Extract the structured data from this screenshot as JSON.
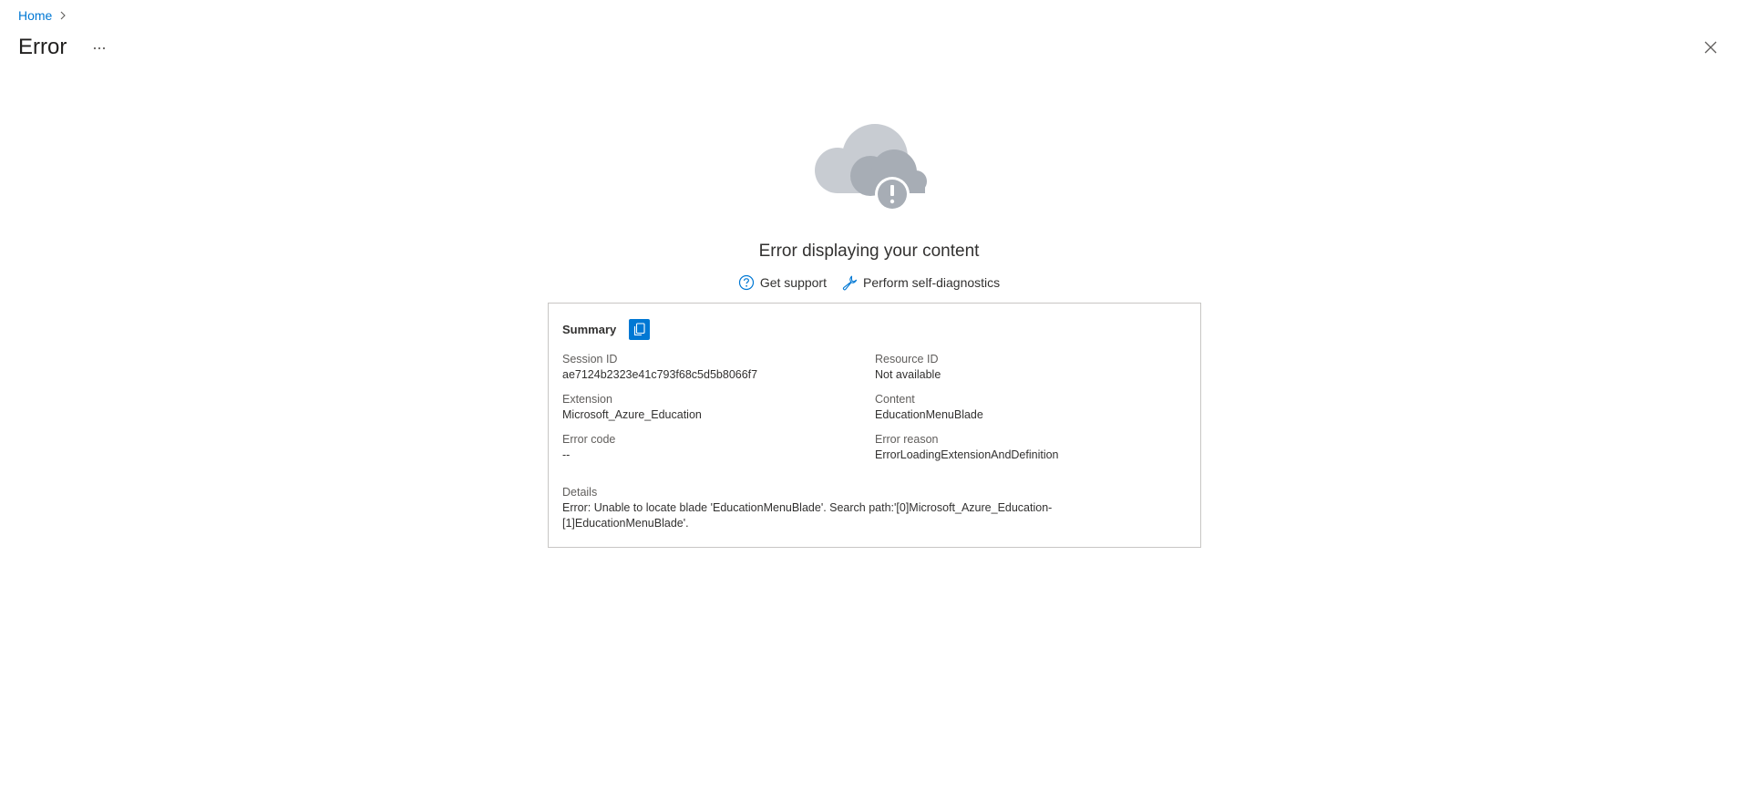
{
  "breadcrumb": {
    "home": "Home"
  },
  "header": {
    "title": "Error",
    "more_label": "···"
  },
  "hero": {
    "title": "Error displaying your content",
    "get_support": "Get support",
    "self_diagnostics": "Perform self-diagnostics"
  },
  "summary": {
    "label": "Summary",
    "fields": {
      "session_id_label": "Session ID",
      "session_id": "ae7124b2323e41c793f68c5d5b8066f7",
      "resource_id_label": "Resource ID",
      "resource_id": "Not available",
      "extension_label": "Extension",
      "extension": "Microsoft_Azure_Education",
      "content_label": "Content",
      "content": "EducationMenuBlade",
      "error_code_label": "Error code",
      "error_code": "--",
      "error_reason_label": "Error reason",
      "error_reason": "ErrorLoadingExtensionAndDefinition"
    },
    "details_label": "Details",
    "details": "Error: Unable to locate blade 'EducationMenuBlade'. Search path:'[0]Microsoft_Azure_Education-[1]EducationMenuBlade'."
  },
  "colors": {
    "accent": "#0078d4",
    "cloud_light": "#c8ccd2",
    "cloud_dark": "#a7adb5"
  }
}
